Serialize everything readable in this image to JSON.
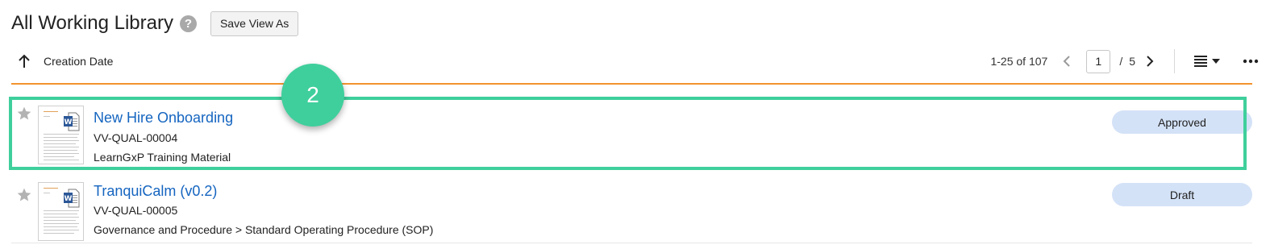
{
  "header": {
    "title": "All Working Library",
    "help_icon": "question-circle-icon",
    "save_view_label": "Save View As"
  },
  "sort": {
    "direction_icon": "arrow-up-icon",
    "label": "Creation Date"
  },
  "pagination": {
    "range": "1-25 of 107",
    "current_page": "1",
    "separator": "/",
    "total_pages": "5"
  },
  "callout": {
    "step_number": "2"
  },
  "documents": [
    {
      "title": "New Hire Onboarding",
      "number": "VV-QUAL-00004",
      "type": "LearnGxP Training Material",
      "status": "Approved",
      "icon": "word-document-icon"
    },
    {
      "title": "TranquiCalm (v0.2)",
      "number": "VV-QUAL-00005",
      "type": "Governance and Procedure > Standard Operating Procedure (SOP)",
      "status": "Draft",
      "icon": "word-document-icon"
    }
  ],
  "colors": {
    "accent_orange": "#f2932e",
    "highlight_green": "#3fcf9c",
    "link_blue": "#1565c0",
    "badge_blue": "#d4e2f7"
  }
}
